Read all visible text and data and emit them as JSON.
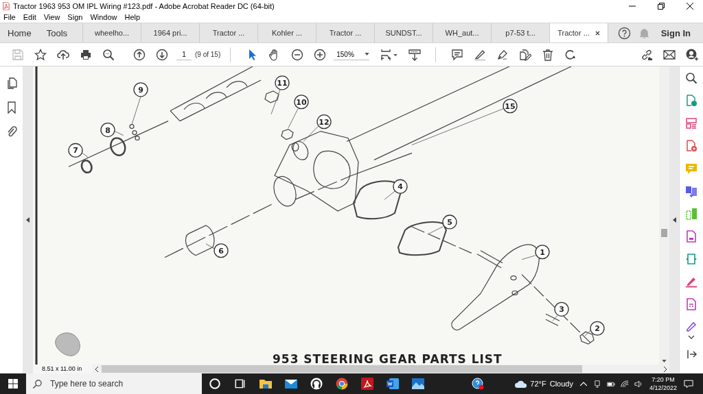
{
  "window": {
    "title": "Tractor 1963 953 OM IPL Wiring #123.pdf - Adobe Acrobat Reader DC (64-bit)"
  },
  "menu": [
    "File",
    "Edit",
    "View",
    "Sign",
    "Window",
    "Help"
  ],
  "tabs": [
    {
      "kind": "nav",
      "label": "Home",
      "selected": false
    },
    {
      "kind": "nav",
      "label": "Tools",
      "selected": false
    },
    {
      "kind": "document",
      "label": "wheelho...",
      "selected": false
    },
    {
      "kind": "document",
      "label": "1964 pri...",
      "selected": false
    },
    {
      "kind": "document",
      "label": "Tractor ...",
      "selected": false
    },
    {
      "kind": "document",
      "label": "Kohler ...",
      "selected": false
    },
    {
      "kind": "document",
      "label": "Tractor ...",
      "selected": false
    },
    {
      "kind": "document",
      "label": "SUNDST...",
      "selected": false
    },
    {
      "kind": "document",
      "label": "WH_aut...",
      "selected": false
    },
    {
      "kind": "document",
      "label": "p7-53 t...",
      "selected": false
    },
    {
      "kind": "document",
      "label": "Tractor ...",
      "selected": true
    }
  ],
  "account": {
    "sign_in": "Sign In"
  },
  "toolbar": {
    "page_number": "1",
    "page_count": "(9 of 15)",
    "zoom": "150%"
  },
  "document": {
    "callouts": [
      "9",
      "8",
      "7",
      "11",
      "10",
      "12",
      "15",
      "4",
      "5",
      "6",
      "1",
      "3",
      "2"
    ],
    "heading": "953  STEERING  GEAR  PARTS  LIST"
  },
  "status_bar": {
    "page_size": "8.51 x 11.00 in"
  },
  "taskbar": {
    "search": {
      "placeholder": "Type here to search"
    },
    "weather": {
      "temperature": "72°F",
      "condition": "Cloudy"
    },
    "clock": {
      "time": "7:20 PM",
      "date": "4/12/2022"
    }
  }
}
